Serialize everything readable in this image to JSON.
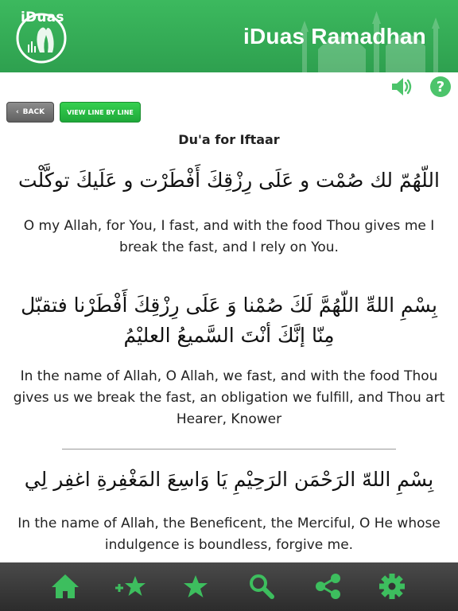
{
  "header": {
    "logo_text": "iDuas",
    "app_title": "iDuas Ramadhan",
    "color": "#34ad55"
  },
  "toolbar": {
    "back_label": "BACK",
    "view_line_label": "VIEW LINE BY LINE",
    "speaker_icon": "speaker-icon",
    "help_icon": "help-icon"
  },
  "content": {
    "title": "Du'a for Iftaar",
    "sections": [
      {
        "arabic": "اللّهُمّ لك صُمْت و عَلَى رِزْقِكَ أَفْطَرْت و عَلَيكَ توكَّلْت",
        "english": "O my Allah, for You, I fast, and with the food Thou gives me I break the fast, and I rely on You."
      },
      {
        "arabic": "بِسْمِ اللهِّ اللّهُمَّ لَكَ صُمْنا وَ عَلَى رِزْقِكَ أَفْطَرْنا فتقبّل مِنّا إنَّكَ أنْتَ السَّميعُ العليْمُ",
        "english": "In the name of Allah, O Allah, we fast, and with the food Thou gives us we break the fast, an obligation we fulfill, and Thou art Hearer, Knower"
      },
      {
        "arabic": "بِسْمِ اللهّ الرَحْمَن  الرَحِيْمِ يَا وَاسِعَ المَغْفِرةِ اغفِر لِي",
        "english": "In the name of Allah, the Beneficent, the Merciful, O He whose indulgence is boundless, forgive me."
      }
    ]
  },
  "tabbar": {
    "items": [
      {
        "icon": "home-icon"
      },
      {
        "icon": "add-favorite-icon"
      },
      {
        "icon": "favorites-icon"
      },
      {
        "icon": "search-icon"
      },
      {
        "icon": "share-icon"
      },
      {
        "icon": "settings-icon"
      }
    ],
    "icon_color": "#3dbe5e"
  }
}
